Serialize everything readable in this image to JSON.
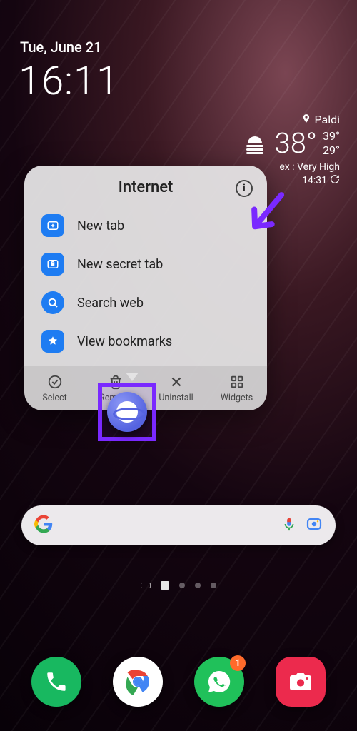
{
  "status": {
    "date": "Tue, June 21",
    "time": "16:11"
  },
  "weather": {
    "location": "Paldi",
    "temp": "38°",
    "high": "39°",
    "low": "29°",
    "index": "ex : Very High",
    "updated": "14:31"
  },
  "popup": {
    "title": "Internet",
    "items": [
      {
        "label": "New tab",
        "icon": "new-tab-icon"
      },
      {
        "label": "New secret tab",
        "icon": "secret-tab-icon"
      },
      {
        "label": "Search web",
        "icon": "search-icon"
      },
      {
        "label": "View bookmarks",
        "icon": "bookmark-icon"
      }
    ],
    "actions": [
      {
        "label": "Select",
        "icon": "select-icon"
      },
      {
        "label": "Remove",
        "icon": "trash-icon"
      },
      {
        "label": "Uninstall",
        "icon": "close-icon"
      },
      {
        "label": "Widgets",
        "icon": "widgets-icon"
      }
    ]
  },
  "highlighted_app": "Samsung Internet",
  "dock": {
    "apps": [
      "Phone",
      "Chrome",
      "WhatsApp",
      "Camera"
    ],
    "badge_whatsapp": "1"
  },
  "annotation": {
    "arrow_color": "#7a29ff",
    "highlight_color": "#7a29ff"
  }
}
